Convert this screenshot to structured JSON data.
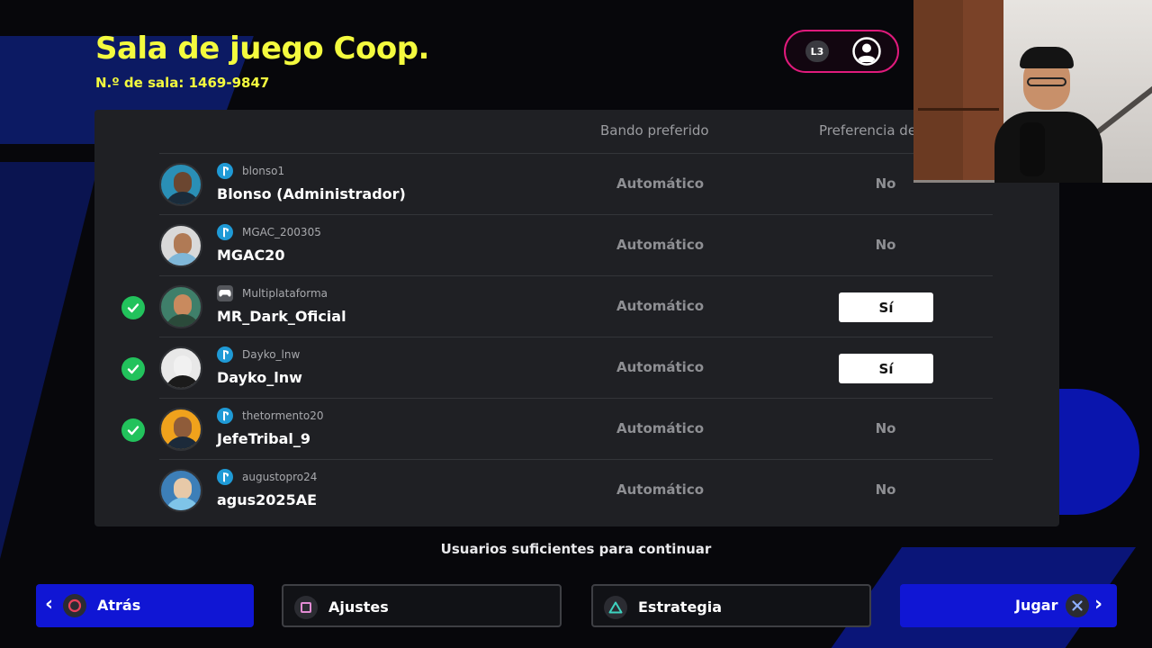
{
  "header": {
    "title": "Sala de juego Coop.",
    "room_number": "N.º de sala: 1469-9847",
    "l3_label": "L3"
  },
  "table": {
    "col_side": "Bando preferido",
    "col_pref": "Preferencia de",
    "rows": [
      {
        "handle": "blonso1",
        "name": "Blonso (Administrador)",
        "side": "Automático",
        "pref": "No",
        "ready": false,
        "platform": "playstation-icon"
      },
      {
        "handle": "MGAC_200305",
        "name": "MGAC20",
        "side": "Automático",
        "pref": "No",
        "ready": false,
        "platform": "playstation-icon"
      },
      {
        "handle": "Multiplataforma",
        "name": "MR_Dark_Oficial",
        "side": "Automático",
        "pref": "Sí",
        "ready": true,
        "platform": "gamepad-icon"
      },
      {
        "handle": "Dayko_lnw",
        "name": "Dayko_lnw",
        "side": "Automático",
        "pref": "Sí",
        "ready": true,
        "platform": "playstation-icon"
      },
      {
        "handle": "thetormento20",
        "name": "JefeTribal_9",
        "side": "Automático",
        "pref": "No",
        "ready": true,
        "platform": "playstation-icon"
      },
      {
        "handle": "augustopro24",
        "name": "agus2025AE",
        "side": "Automático",
        "pref": "No",
        "ready": false,
        "platform": "playstation-icon"
      }
    ]
  },
  "status_message": "Usuarios suficientes para continuar",
  "footer": {
    "back_label": "Atrás",
    "settings_label": "Ajustes",
    "strategy_label": "Estrategia",
    "play_label": "Jugar"
  },
  "colors": {
    "accent_yellow": "#f4fb3e",
    "accent_blue": "#1016d4",
    "accent_pink": "#e01a7c",
    "ready_green": "#22c25c"
  }
}
